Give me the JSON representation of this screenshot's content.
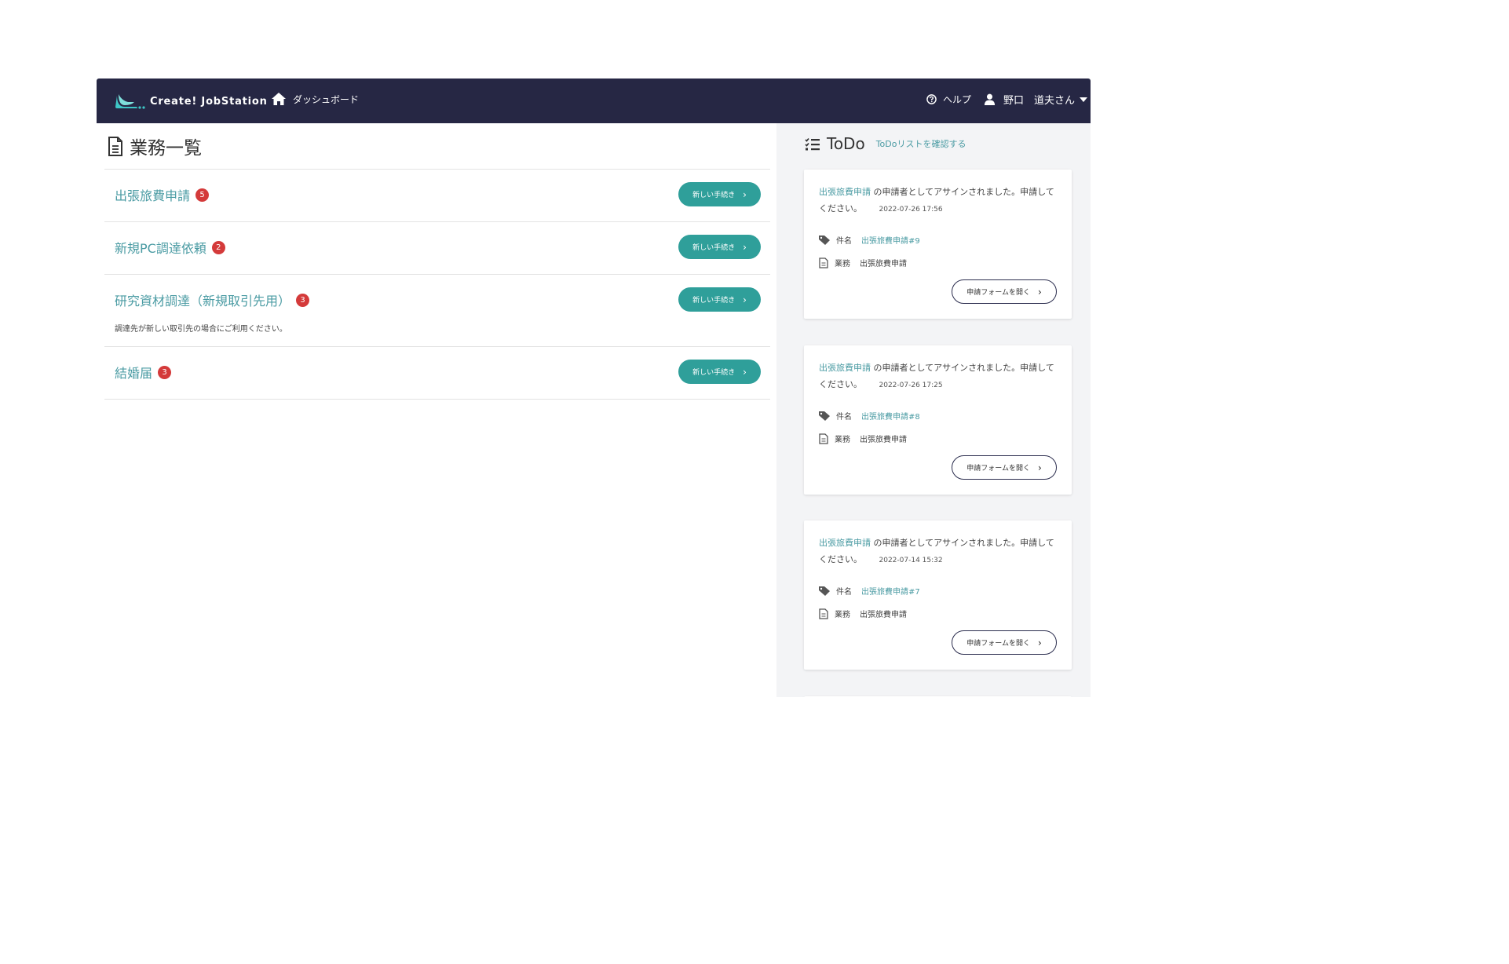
{
  "navbar": {
    "brand": "Create! JobStation",
    "dashboard_label": "ダッシュボード",
    "help_label": "ヘルプ",
    "user_name": "野口　道夫さん"
  },
  "main": {
    "title": "業務一覧",
    "items": [
      {
        "name": "出張旅費申請",
        "count": "5",
        "button": "新しい手続き",
        "description": ""
      },
      {
        "name": "新規PC調達依頼",
        "count": "2",
        "button": "新しい手続き",
        "description": ""
      },
      {
        "name": "研究資材調達（新規取引先用）",
        "count": "3",
        "button": "新しい手続き",
        "description": "調達先が新しい取引先の場合にご利用ください。"
      },
      {
        "name": "結婚届",
        "count": "3",
        "button": "新しい手続き",
        "description": ""
      }
    ]
  },
  "todo": {
    "title": "ToDo",
    "link": "ToDoリストを確認する",
    "cards": [
      {
        "form_link": "出張旅費申請",
        "message": "の申請者としてアサインされました。申請してください。",
        "timestamp": "2022-07-26 17:56",
        "subject_label": "件名",
        "subject": "出張旅費申請#9",
        "business_label": "業務",
        "business": "出張旅費申請",
        "button": "申請フォームを開く"
      },
      {
        "form_link": "出張旅費申請",
        "message": "の申請者としてアサインされました。申請してください。",
        "timestamp": "2022-07-26 17:25",
        "subject_label": "件名",
        "subject": "出張旅費申請#8",
        "business_label": "業務",
        "business": "出張旅費申請",
        "button": "申請フォームを開く"
      },
      {
        "form_link": "出張旅費申請",
        "message": "の申請者としてアサインされました。申請してください。",
        "timestamp": "2022-07-14 15:32",
        "subject_label": "件名",
        "subject": "出張旅費申請#7",
        "business_label": "業務",
        "business": "出張旅費申請",
        "button": "申請フォームを開く"
      }
    ]
  },
  "colors": {
    "navbar": "#262744",
    "accent": "#2f9f9a",
    "link": "#4a9ba3",
    "badge": "#d43a3a",
    "sidebar_bg": "#f3f4f6"
  }
}
